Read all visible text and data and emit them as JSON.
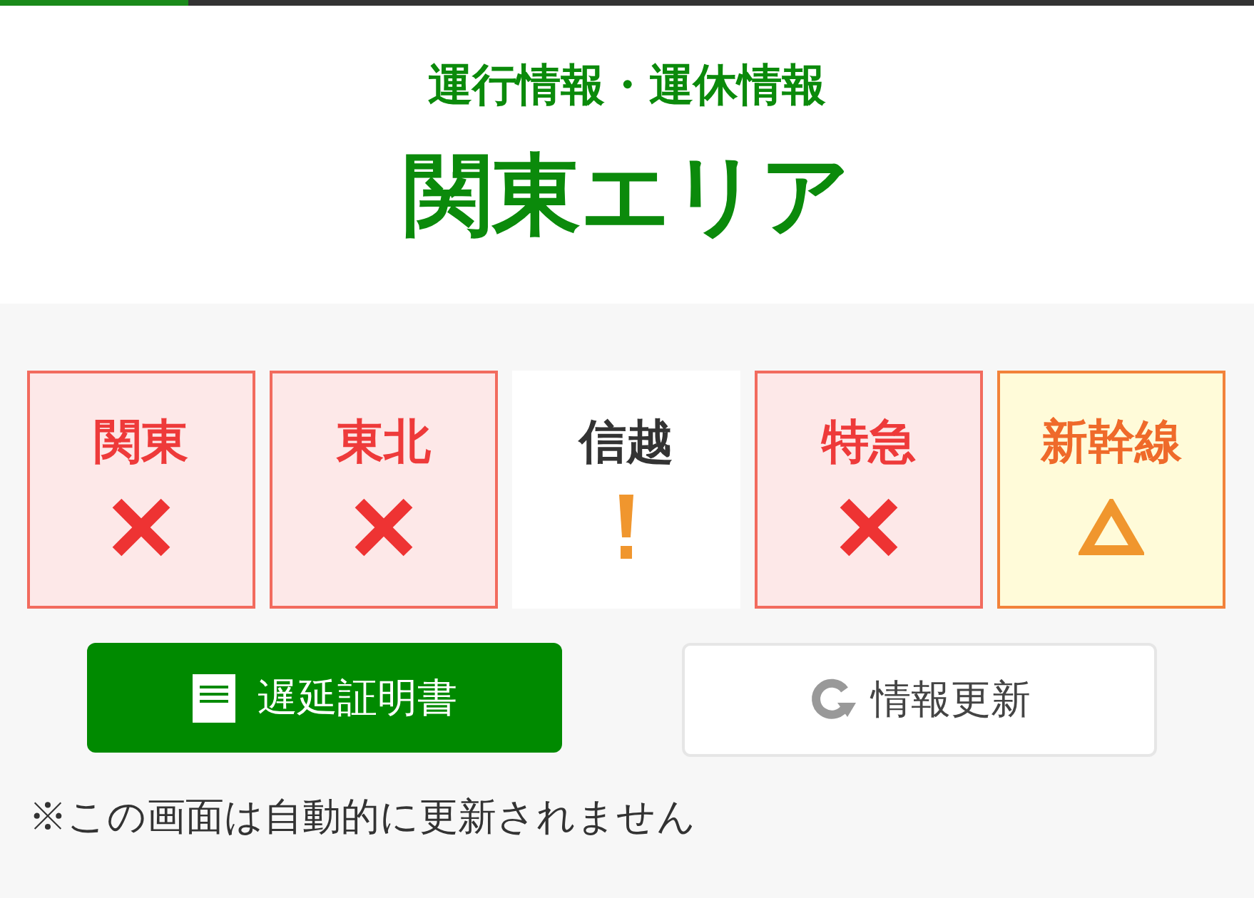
{
  "progress": {
    "level": 0.15
  },
  "header": {
    "subtitle": "運行情報・運休情報",
    "title": "関東エリア"
  },
  "areas": [
    {
      "label": "関東",
      "kind": "suspended"
    },
    {
      "label": "東北",
      "kind": "suspended"
    },
    {
      "label": "信越",
      "kind": "notice"
    },
    {
      "label": "特急",
      "kind": "suspended"
    },
    {
      "label": "新幹線",
      "kind": "delay"
    }
  ],
  "buttons": [
    {
      "label": "遅延証明書",
      "kind": "primary"
    },
    {
      "label": "情報更新",
      "kind": "refresh"
    }
  ],
  "note": "※この画面は自動的に更新されません"
}
